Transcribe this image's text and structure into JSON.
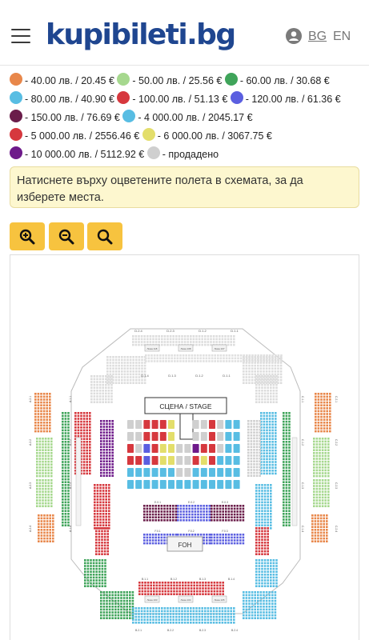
{
  "header": {
    "logo": "kupibileti.bg",
    "menu_icon": "hamburger-menu-icon",
    "user_icon": "user-account-icon",
    "lang_bg": "BG",
    "lang_en": "EN"
  },
  "legend": {
    "items": [
      {
        "color": "#e8874a",
        "text": "- 40.00 лв. / 20.45 €"
      },
      {
        "color": "#a6d88e",
        "text": "- 50.00 лв. / 25.56 €"
      },
      {
        "color": "#3fa45a",
        "text": "- 60.00 лв. / 30.68 €"
      },
      {
        "color": "#58bde3",
        "text": "- 80.00 лв. / 40.90 €"
      },
      {
        "color": "#d6383e",
        "text": "- 100.00 лв. / 51.13 €"
      },
      {
        "color": "#5b5fe0",
        "text": "- 120.00 лв. / 61.36 €"
      },
      {
        "color": "#6a1d4a",
        "text": "- 150.00 лв. / 76.69 €"
      },
      {
        "color": "#58bde3",
        "text": "- 4 000.00 лв. / 2045.17 €"
      },
      {
        "color": "#d6383e",
        "text": "- 5 000.00 лв. / 2556.46 €"
      },
      {
        "color": "#e3de6b",
        "text": "- 6 000.00 лв. / 3067.75 €"
      },
      {
        "color": "#6e1a8a",
        "text": "- 10 000.00 лв. / 5112.92 €"
      },
      {
        "color": "#cfcfcf",
        "text": "- продадено"
      }
    ]
  },
  "notice": "Натиснете върху оцветените полета в схемата, за да изберете места.",
  "zoom": {
    "zoom_in_icon": "zoom-in-icon",
    "zoom_out_icon": "zoom-out-icon",
    "zoom_reset_icon": "search-icon"
  },
  "seating_map": {
    "stage_label": "СЦЕНА / STAGE",
    "foh_label": "FOH",
    "floor_top_labels": [
      "Е.0.1",
      "Е.0.2",
      "Е.0.3"
    ],
    "floor_bottom_labels": [
      "F.0.1",
      "F.0.2",
      "F.0.3"
    ],
    "top_tier_labels": [
      "D.2.4",
      "D.2.3",
      "D.1.2",
      "D.1.1"
    ],
    "top_inner_labels": [
      "D.1.4",
      "D.1.3",
      "D.1.2",
      "D.1.1"
    ],
    "top_box_labels": [
      "Ложа 118",
      "Ложа 108",
      "Ложа 107"
    ],
    "bottom_tier_labels": [
      "B.1.1",
      "B.1.2",
      "B.1.3",
      "B.1.4"
    ],
    "bottom_outer_labels": [
      "B.2.1",
      "B.2.2",
      "B.2.3",
      "B.2.4"
    ],
    "bottom_box_labels": [
      "Ложа 103",
      "Ложа 104",
      "Ложа 105"
    ],
    "left_labels": [
      "A.2.1",
      "A.2.2",
      "A.2.3",
      "A.2.4",
      "A.1.1",
      "A.1.2",
      "A.1.3",
      "A.1.4"
    ],
    "right_labels": [
      "C.1.1",
      "C.1.2",
      "C.1.3",
      "C.1.4",
      "C.2.1",
      "C.2.2",
      "C.2.3",
      "C.2.4"
    ]
  }
}
